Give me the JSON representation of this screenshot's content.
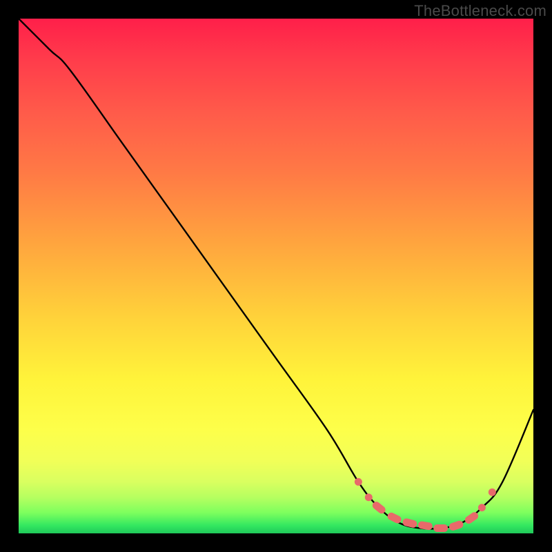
{
  "watermark": "TheBottleneck.com",
  "chart_data": {
    "type": "line",
    "title": "",
    "xlabel": "",
    "ylabel": "",
    "xlim": [
      0,
      100
    ],
    "ylim": [
      0,
      100
    ],
    "series": [
      {
        "name": "bottleneck-curve",
        "x": [
          0,
          6,
          10,
          20,
          30,
          40,
          50,
          60,
          66,
          70,
          74,
          78,
          82,
          86,
          90,
          94,
          100
        ],
        "values": [
          100,
          94,
          90,
          76,
          62,
          48,
          34,
          20,
          10,
          5,
          2,
          1,
          1,
          2,
          5,
          10,
          24
        ]
      }
    ],
    "markers": {
      "name": "highlight-dots",
      "color": "#e86a6a",
      "x": [
        66,
        68,
        70,
        73,
        76,
        79,
        82,
        85,
        88,
        90,
        92
      ],
      "values": [
        10,
        7,
        5,
        3,
        2,
        1.5,
        1,
        1.5,
        3,
        5,
        8
      ],
      "density": [
        1,
        1,
        2,
        2,
        2,
        2,
        2,
        2,
        2,
        1,
        1
      ]
    }
  }
}
